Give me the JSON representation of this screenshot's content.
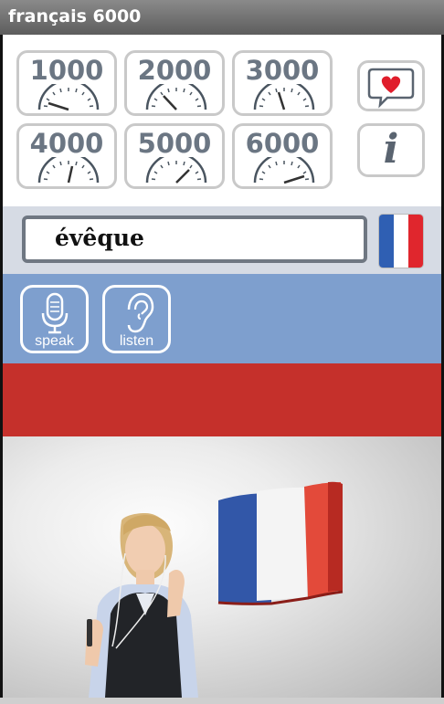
{
  "window": {
    "title": "français 6000"
  },
  "levels": [
    {
      "label": "1000"
    },
    {
      "label": "2000"
    },
    {
      "label": "3000"
    },
    {
      "label": "4000"
    },
    {
      "label": "5000"
    },
    {
      "label": "6000"
    }
  ],
  "side_buttons": {
    "favorites_icon": "heart-speech-icon",
    "info_icon": "info-icon",
    "info_glyph": "i"
  },
  "word": {
    "value": "évêque"
  },
  "language_flag": {
    "icon": "french-flag-icon"
  },
  "actions": {
    "speak_label": "speak",
    "listen_label": "listen"
  },
  "colors": {
    "blue_band": "#7e9fce",
    "red_band": "#c5302b",
    "word_band": "#d6dbe4"
  }
}
